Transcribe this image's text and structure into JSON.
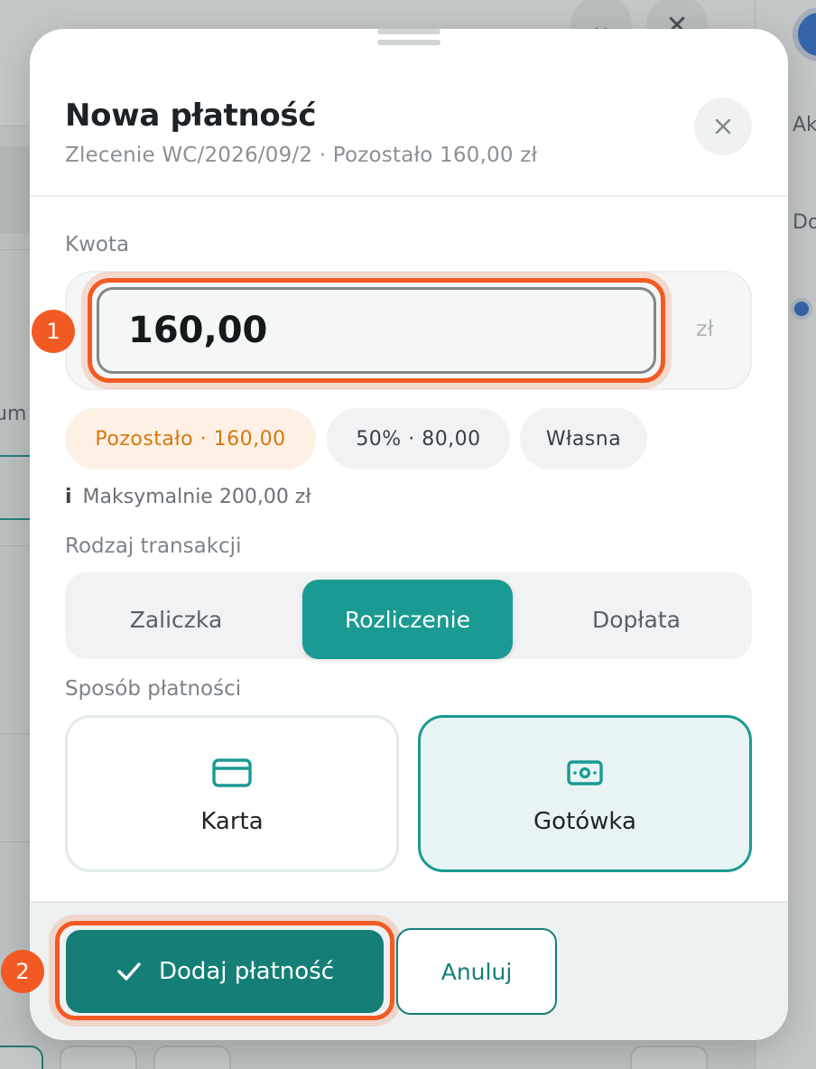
{
  "background": {
    "side_labels": [
      "Ak",
      "Do",
      "um"
    ]
  },
  "modal": {
    "title": "Nowa płatność",
    "subtitle": "Zlecenie WC/2026/09/2 · Pozostało 160,00 zł",
    "close_icon": "close-icon"
  },
  "amount": {
    "label": "Kwota",
    "value": "160,00",
    "currency": "zł",
    "presets": [
      {
        "label": "Pozostało · 160,00",
        "active": true
      },
      {
        "label": "50% · 80,00",
        "active": false
      },
      {
        "label": "Własna",
        "active": false
      }
    ],
    "hint_icon": "i",
    "hint": "Maksymalnie 200,00 zł"
  },
  "transaction_type": {
    "label": "Rodzaj transakcji",
    "options": [
      {
        "label": "Zaliczka",
        "active": false
      },
      {
        "label": "Rozliczenie",
        "active": true
      },
      {
        "label": "Dopłata",
        "active": false
      }
    ]
  },
  "payment_method": {
    "label": "Sposób płatności",
    "options": [
      {
        "label": "Karta",
        "icon": "credit-card-icon",
        "active": false
      },
      {
        "label": "Gotówka",
        "icon": "cash-icon",
        "active": true
      }
    ]
  },
  "footer": {
    "submit_label": "Dodaj płatność",
    "submit_icon": "check-icon",
    "cancel_label": "Anuluj"
  },
  "steps": [
    "1",
    "2"
  ],
  "colors": {
    "accent": "#1a9a92",
    "accent_dark": "#157f77",
    "highlight": "#f25a23",
    "preset_active_text": "#d9770e",
    "preset_active_bg": "#fdf1e5"
  }
}
